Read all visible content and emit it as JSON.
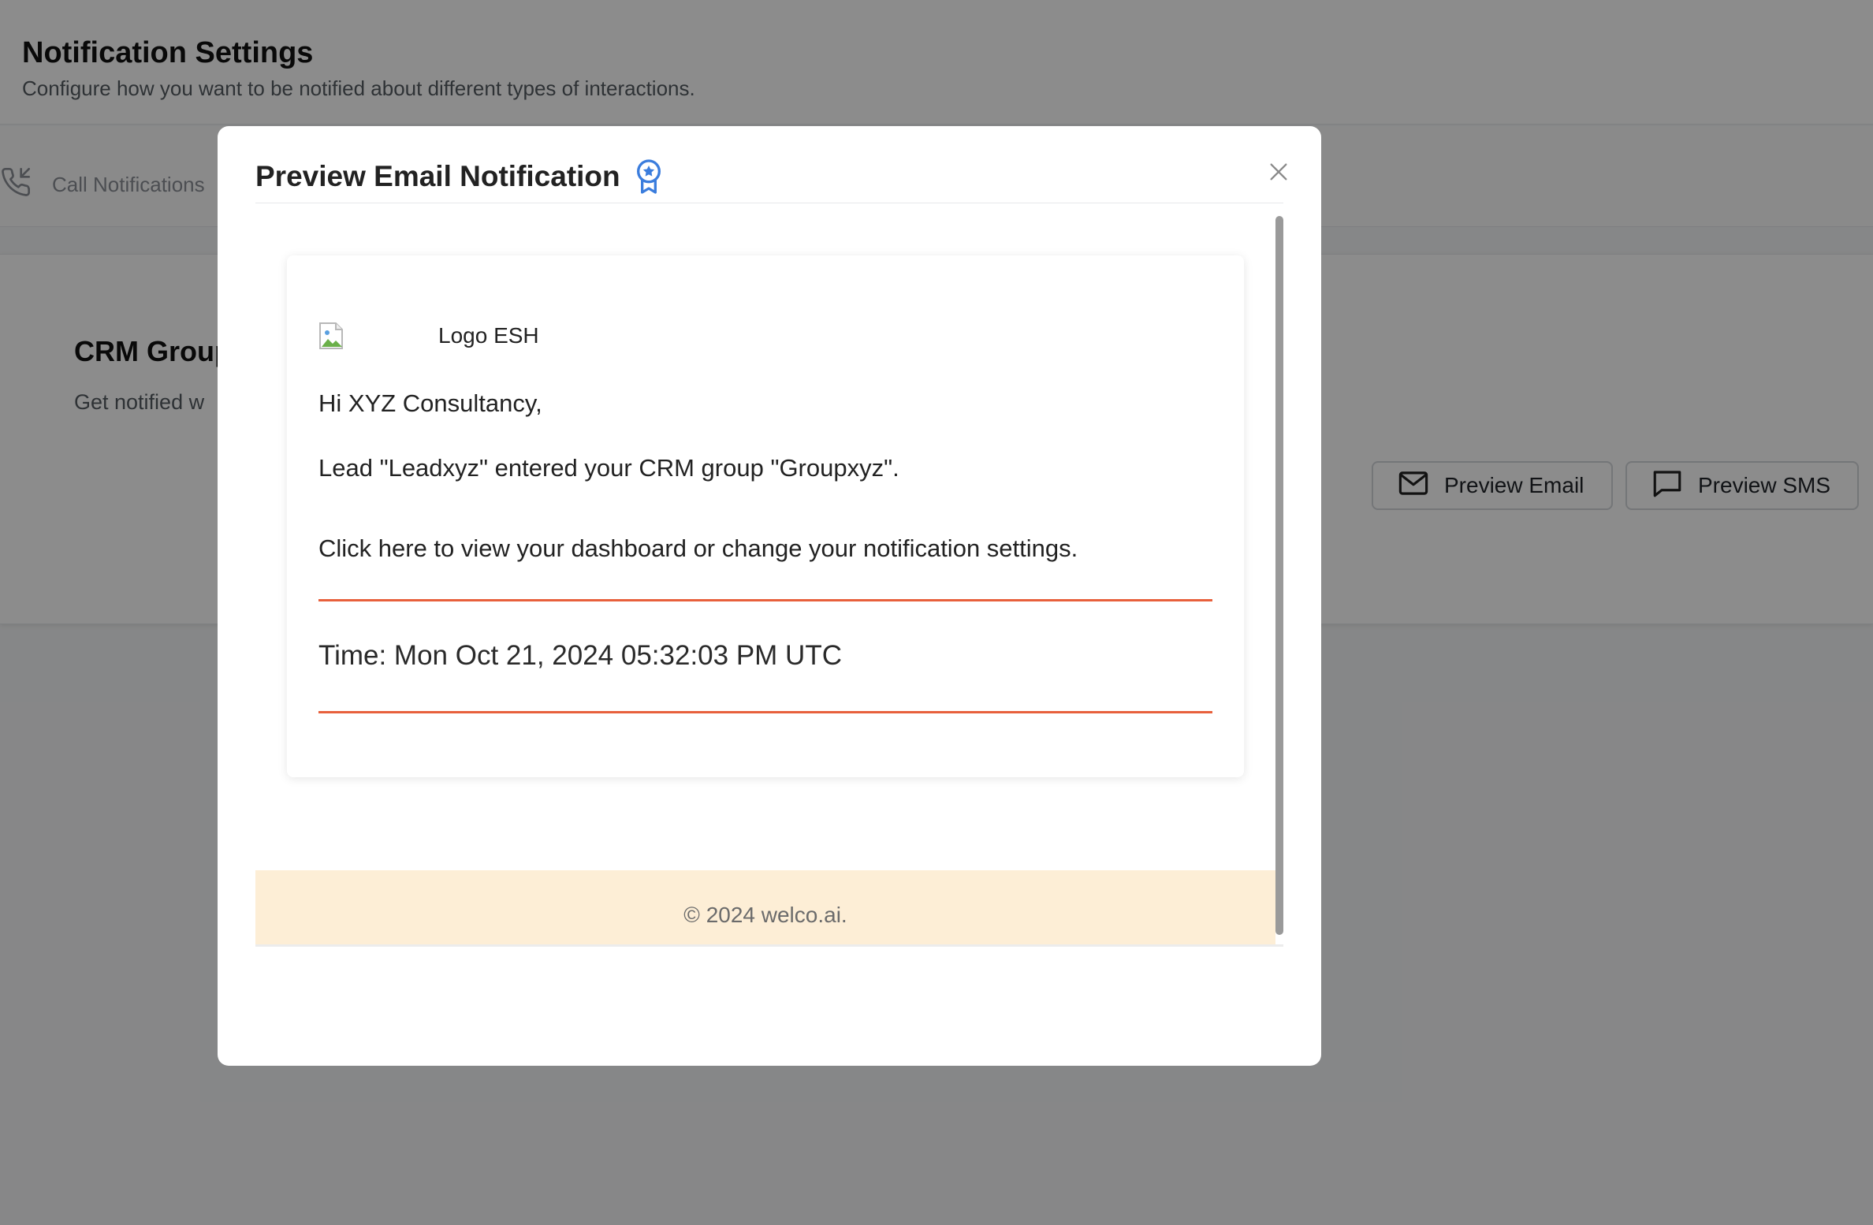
{
  "page": {
    "title": "Notification Settings",
    "subtitle": "Configure how you want to be notified about different types of interactions."
  },
  "tabs": [
    {
      "label": "Call Notifications",
      "icon": "phone-incoming-icon"
    }
  ],
  "card": {
    "title": "CRM Group",
    "description": "Get notified w",
    "preview_email_label": "Preview Email",
    "preview_sms_label": "Preview SMS"
  },
  "modal": {
    "title": "Preview Email Notification",
    "title_icon": "award-badge-icon",
    "close_icon": "close-icon",
    "email": {
      "logo_alt": "Logo ESH",
      "greeting": "Hi XYZ Consultancy,",
      "lead_message": "Lead \"Leadxyz\" entered your CRM group \"Groupxyz\".",
      "link_text": "Click here to view your dashboard or change your notification settings.",
      "time_text": "Time: Mon Oct 21, 2024 05:32:03 PM UTC",
      "footer": "© 2024 welco.ai."
    }
  },
  "colors": {
    "accent_rule": "#e8603c",
    "footer_bg": "#fdeed6",
    "badge_blue": "#3b7ddd",
    "overlay": "rgba(0,0,0,0.45)"
  }
}
